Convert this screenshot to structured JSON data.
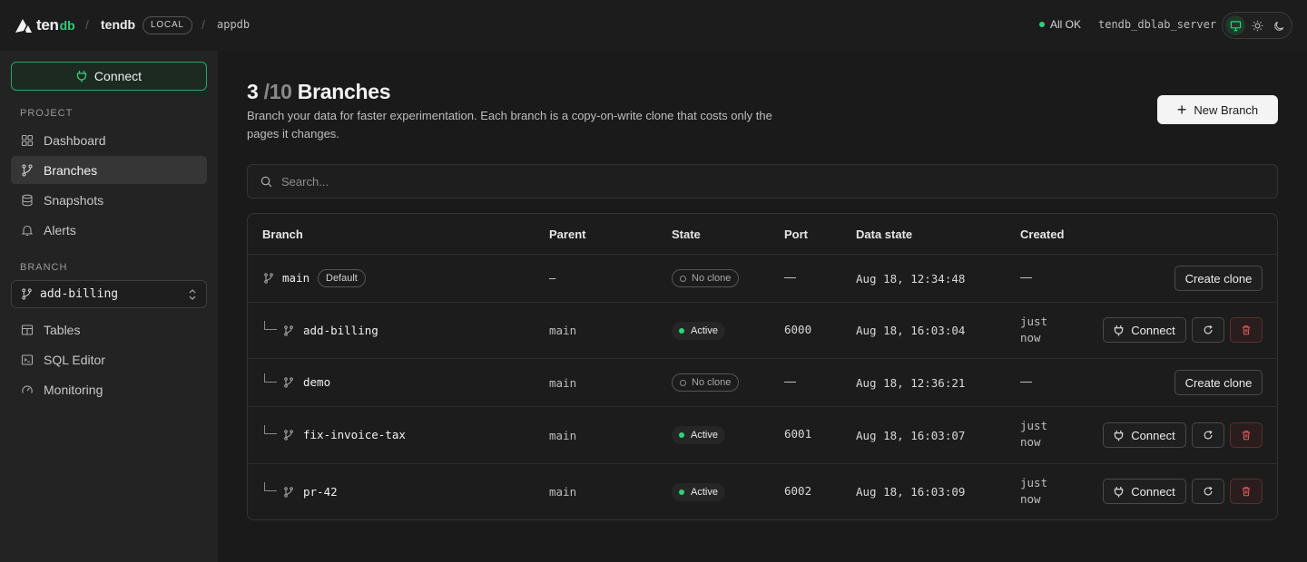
{
  "topbar": {
    "logo_ten": "ten",
    "logo_db": "db",
    "project": "tendb",
    "env_badge": "LOCAL",
    "database": "appdb",
    "status": "All OK",
    "server": "tendb_dblab_server"
  },
  "sidebar": {
    "connect_label": "Connect",
    "project_section": "PROJECT",
    "nav": [
      {
        "label": "Dashboard",
        "icon": "grid-icon"
      },
      {
        "label": "Branches",
        "icon": "branch-icon",
        "active": true
      },
      {
        "label": "Snapshots",
        "icon": "database-icon"
      },
      {
        "label": "Alerts",
        "icon": "bell-icon"
      }
    ],
    "branch_section": "BRANCH",
    "selected_branch": "add-billing",
    "branch_nav": [
      {
        "label": "Tables",
        "icon": "table-icon"
      },
      {
        "label": "SQL Editor",
        "icon": "terminal-icon"
      },
      {
        "label": "Monitoring",
        "icon": "gauge-icon"
      }
    ]
  },
  "main": {
    "count_current": "3",
    "count_sep": "/",
    "count_total": "10",
    "title": "Branches",
    "description": "Branch your data for faster experimentation. Each branch is a copy-on-write clone that costs only the pages it changes.",
    "new_branch_label": "New Branch",
    "search_placeholder": "Search...",
    "columns": [
      "Branch",
      "Parent",
      "State",
      "Port",
      "Data state",
      "Created"
    ],
    "rows": [
      {
        "name": "main",
        "badge": "Default",
        "parent": "–",
        "state": "No clone",
        "port": "—",
        "data_state": "Aug 18, 12:34:48",
        "created": "—",
        "action": "Create clone"
      },
      {
        "name": "add-billing",
        "parent": "main",
        "state": "Active",
        "port": "6000",
        "data_state": "Aug 18, 16:03:04",
        "created_1": "just",
        "created_2": "now",
        "action": "Connect"
      },
      {
        "name": "demo",
        "parent": "main",
        "state": "No clone",
        "port": "—",
        "data_state": "Aug 18, 12:36:21",
        "created": "—",
        "action": "Create clone"
      },
      {
        "name": "fix-invoice-tax",
        "parent": "main",
        "state": "Active",
        "port": "6001",
        "data_state": "Aug 18, 16:03:07",
        "created_1": "just",
        "created_2": "now",
        "action": "Connect"
      },
      {
        "name": "pr-42",
        "parent": "main",
        "state": "Active",
        "port": "6002",
        "data_state": "Aug 18, 16:03:09",
        "created_1": "just",
        "created_2": "now",
        "action": "Connect"
      }
    ]
  },
  "colors": {
    "accent": "#2fd27a",
    "background": "#1a1a1a",
    "sidebar": "#232323"
  }
}
